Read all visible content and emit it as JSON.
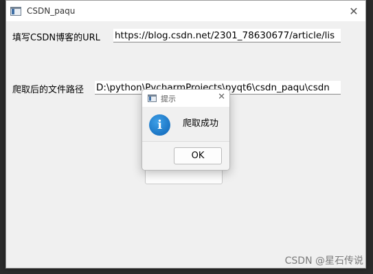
{
  "window": {
    "title": "CSDN_paqu",
    "close_glyph": "✕"
  },
  "form": {
    "url_label": "填写CSDN博客的URL",
    "url_value": "https://blog.csdn.net/2301_78630677/article/lis",
    "path_label": "爬取后的文件路径",
    "path_value": "D:\\python\\PycharmProjects\\pyqt6\\csdn_paqu\\csdn"
  },
  "dialog": {
    "title": "提示",
    "close_glyph": "✕",
    "icon": "info-icon",
    "icon_glyph": "i",
    "message": "爬取成功",
    "ok_label": "OK"
  },
  "watermark": "CSDN @星石传说",
  "colors": {
    "info_blue": "#1a73c8",
    "window_bg": "#f0f0f0",
    "backdrop": "#1e1e1e"
  }
}
